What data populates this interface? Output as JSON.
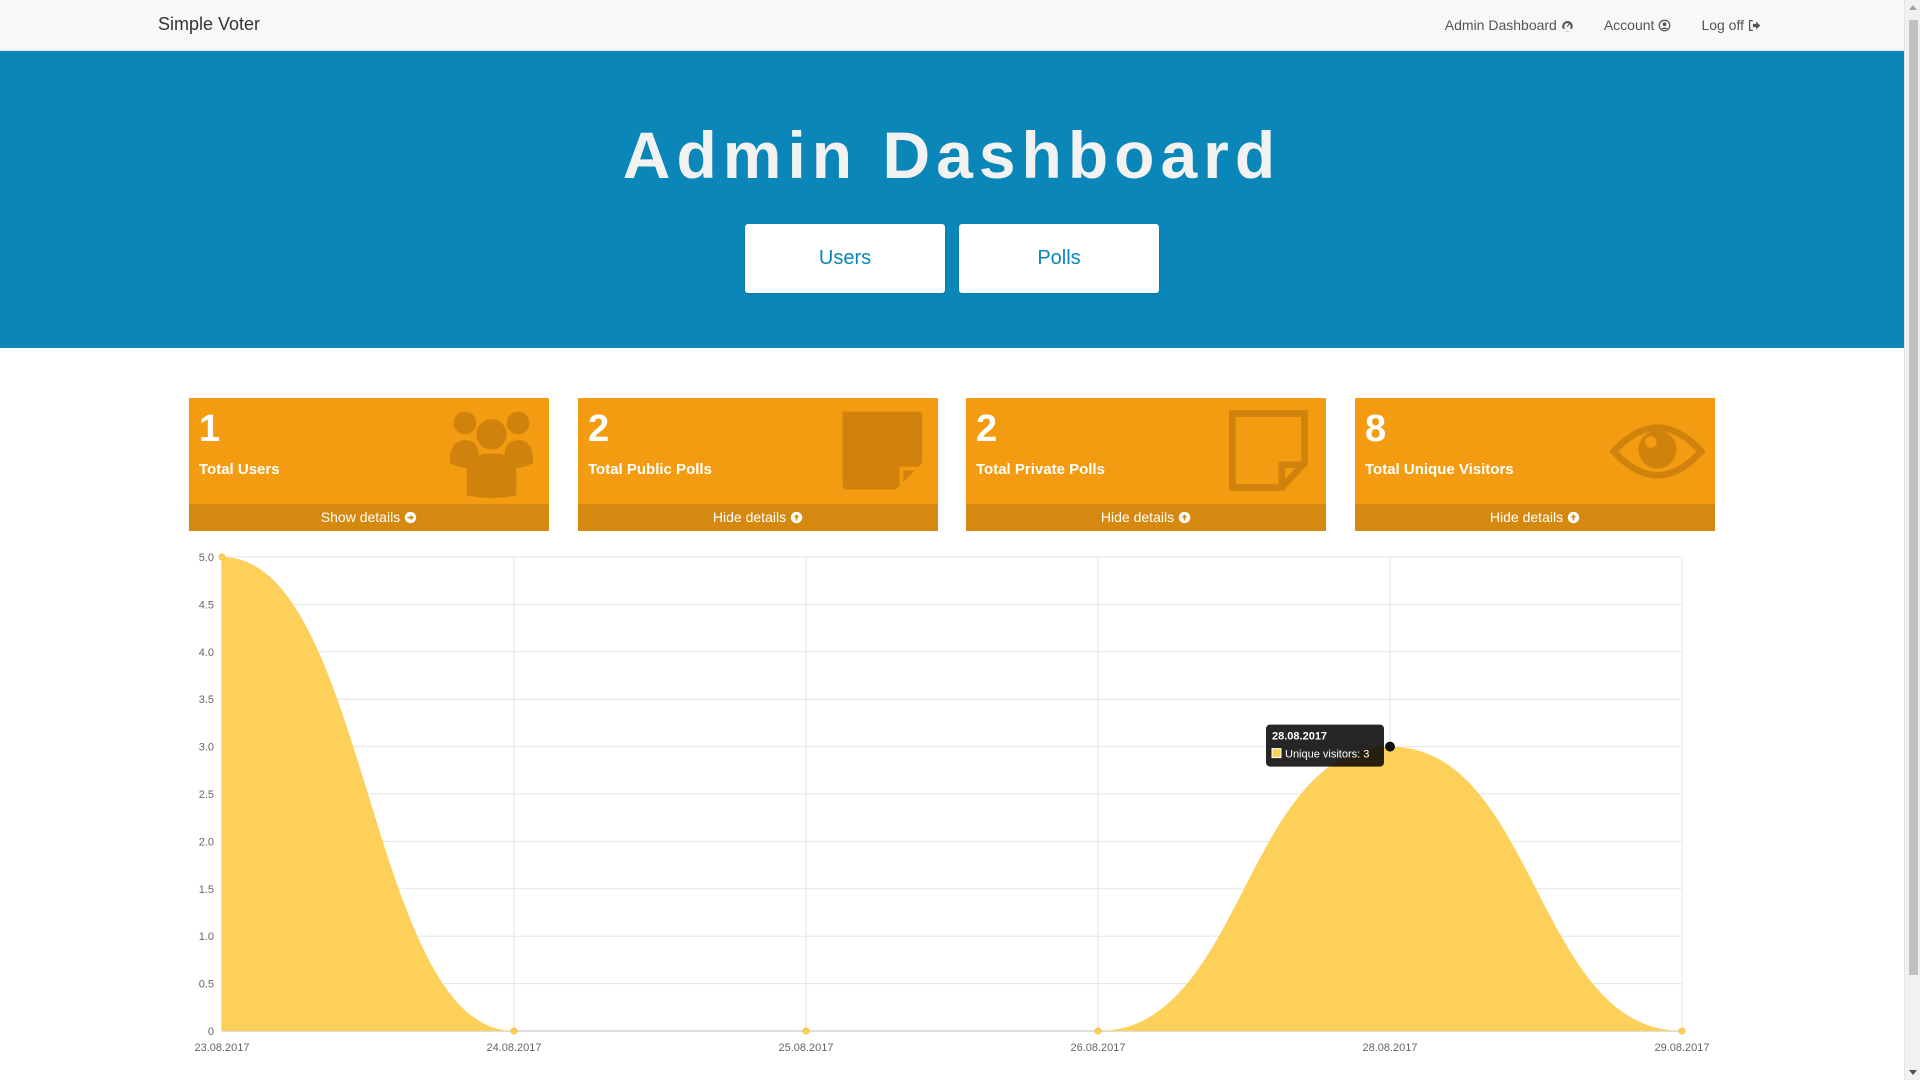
{
  "navbar": {
    "brand": "Simple Voter",
    "links": [
      {
        "label": "Admin Dashboard",
        "icon": "dashboard-icon"
      },
      {
        "label": "Account",
        "icon": "user-circle-icon"
      },
      {
        "label": "Log off",
        "icon": "sign-out-icon"
      }
    ]
  },
  "hero": {
    "title": "Admin Dashboard",
    "buttons": [
      "Users",
      "Polls"
    ]
  },
  "cards": [
    {
      "value": "1",
      "label": "Total Users",
      "footer": "Show details",
      "icon": "users-group-icon"
    },
    {
      "value": "2",
      "label": "Total Public Polls",
      "footer": "Hide details",
      "icon": "sticky-note-filled-icon"
    },
    {
      "value": "2",
      "label": "Total Private Polls",
      "footer": "Hide details",
      "icon": "sticky-note-outline-icon"
    },
    {
      "value": "8",
      "label": "Total Unique Visitors",
      "footer": "Hide details",
      "icon": "eye-icon"
    }
  ],
  "colors": {
    "navbar_bg": "#f8f8f8",
    "hero_bg": "#0a86b8",
    "card_bg": "#f39c12",
    "card_footer_bg": "#d68910",
    "area_fill": "#fdd05a"
  },
  "chart_data": {
    "type": "area",
    "x": [
      "23.08.2017",
      "24.08.2017",
      "25.08.2017",
      "26.08.2017",
      "28.08.2017",
      "29.08.2017"
    ],
    "series": [
      {
        "name": "Unique visitors",
        "values": [
          5,
          0,
          0,
          0,
          3,
          0
        ]
      }
    ],
    "ylim": [
      0,
      5
    ],
    "yticks": [
      "0",
      "0.5",
      "1.0",
      "1.5",
      "2.0",
      "2.5",
      "3.0",
      "3.5",
      "4.0",
      "4.5",
      "5.0"
    ],
    "grid": true,
    "tooltip": {
      "title": "28.08.2017",
      "series": "Unique visitors",
      "value": "3"
    }
  }
}
